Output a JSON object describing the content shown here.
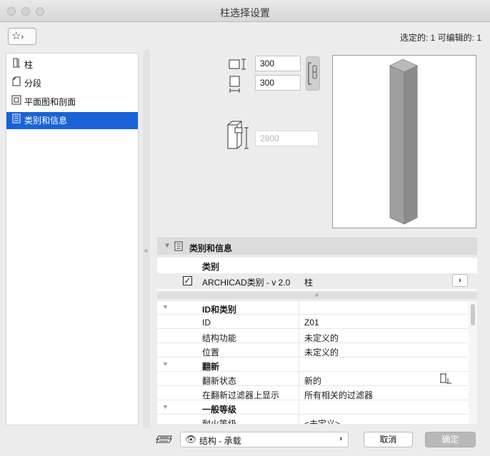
{
  "window": {
    "title": "柱选择设置"
  },
  "toolbar": {
    "favorites_glyph": "☆",
    "favorites_chevron": "›"
  },
  "selection_info": "选定的: 1 可编辑的: 1",
  "sidebar": {
    "items": [
      {
        "label": "柱",
        "icon": "column-icon",
        "active": false
      },
      {
        "label": "分段",
        "icon": "segment-icon",
        "active": false
      },
      {
        "label": "平面图和剖面",
        "icon": "floor-plan-icon",
        "active": false
      },
      {
        "label": "类别和信息",
        "icon": "document-icon",
        "active": true
      }
    ]
  },
  "dimensions": {
    "width": "300",
    "depth": "300",
    "height": "2800"
  },
  "panel": {
    "title": "类别和信息",
    "category_header": "类别",
    "category_row": {
      "checked": true,
      "name": "ARCHICAD类别 - v 2.0",
      "value": "柱"
    }
  },
  "properties": [
    {
      "type": "group",
      "key": "ID和类别",
      "value": ""
    },
    {
      "type": "row",
      "key": "ID",
      "value": "Z01"
    },
    {
      "type": "row",
      "key": "结构功能",
      "value": "未定义的"
    },
    {
      "type": "row",
      "key": "位置",
      "value": "未定义的"
    },
    {
      "type": "group",
      "key": "翻新",
      "value": ""
    },
    {
      "type": "row",
      "key": "翻新状态",
      "value": "新的"
    },
    {
      "type": "row",
      "key": "在翻新过滤器上显示",
      "value": "所有相关的过滤器"
    },
    {
      "type": "group",
      "key": "一般等级",
      "value": ""
    },
    {
      "type": "row",
      "key": "耐火等级",
      "value": "<未定义>"
    }
  ],
  "footer": {
    "structure_label": "结构 - 承载",
    "cancel_label": "取消",
    "ok_label": "确定"
  },
  "colors": {
    "accent": "#1a63d6",
    "column_fill": "#9b9b9b",
    "column_top": "#b8b8b8"
  }
}
